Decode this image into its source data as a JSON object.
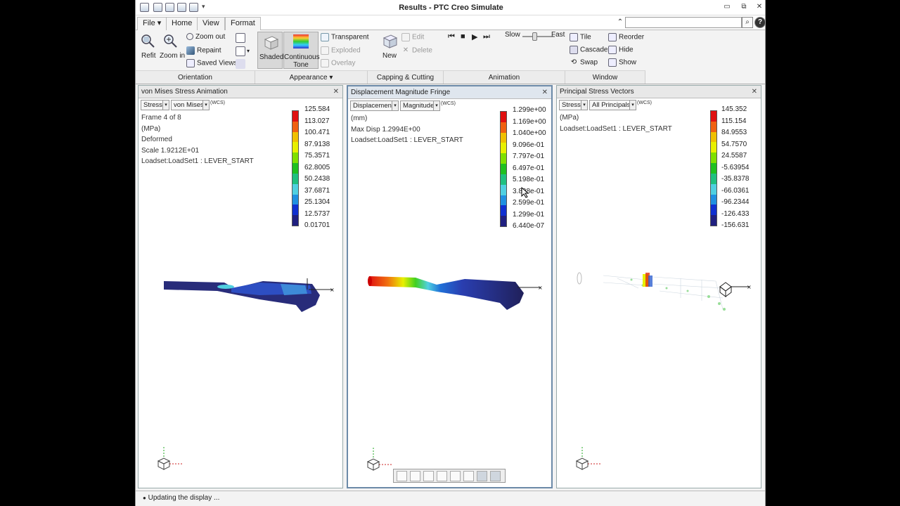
{
  "window": {
    "title": "Results - PTC Creo Simulate",
    "controls": [
      "minimize-icon",
      "restore-icon",
      "close-icon"
    ]
  },
  "tabs": [
    {
      "label": "File",
      "active": false
    },
    {
      "label": "Home",
      "active": false
    },
    {
      "label": "View",
      "active": true
    },
    {
      "label": "Format",
      "active": false
    }
  ],
  "search": {
    "value": ""
  },
  "ribbon": {
    "orientation": {
      "label": "Orientation",
      "refit": "Refit",
      "zoom_in": "Zoom in",
      "zoom_out": "Zoom out",
      "repaint": "Repaint",
      "saved_views": "Saved Views"
    },
    "appearance": {
      "label": "Appearance",
      "shaded": "Shaded",
      "continuous_tone_line1": "Continuous",
      "continuous_tone_line2": "Tone",
      "transparent": "Transparent",
      "exploded": "Exploded",
      "overlay": "Overlay"
    },
    "capping": {
      "label": "Capping & Cutting Surfs",
      "new": "New",
      "edit": "Edit",
      "delete": "Delete"
    },
    "animation": {
      "label": "Animation",
      "slow": "Slow",
      "fast": "Fast",
      "speed_fraction": 0.35
    },
    "window": {
      "label": "Window",
      "tile": "Tile",
      "cascade": "Cascade",
      "swap": "Swap",
      "reorder": "Reorder",
      "hide": "Hide",
      "show": "Show"
    }
  },
  "panels": [
    {
      "title": "von Mises Stress Animation",
      "dropdown1": "Stress",
      "dropdown2": "von Mises",
      "wcs": "(WCS)",
      "info": [
        "Frame 4 of 8",
        "(MPa)",
        "Deformed",
        "Scale  1.9212E+01",
        "Loadset:LoadSet1 :  LEVER_START"
      ],
      "legend": [
        "125.584",
        "113.027",
        "100.471",
        "87.9138",
        "75.3571",
        "62.8005",
        "50.2438",
        "37.6871",
        "25.1304",
        "12.5737",
        "0.01701"
      ]
    },
    {
      "title": "Displacement Magnitude Fringe",
      "dropdown1": "Displacement",
      "dropdown2": "Magnitude",
      "wcs": "(WCS)",
      "info": [
        "(mm)",
        "Max Disp  1.2994E+00",
        "Loadset:LoadSet1 :  LEVER_START"
      ],
      "legend": [
        "1.299e+00",
        "1.169e+00",
        "1.040e+00",
        "9.096e-01",
        "7.797e-01",
        "6.497e-01",
        "5.198e-01",
        "3.898e-01",
        "2.599e-01",
        "1.299e-01",
        "6.440e-07"
      ]
    },
    {
      "title": "Principal Stress Vectors",
      "dropdown1": "Stress",
      "dropdown2": "All Principals",
      "wcs": "(WCS)",
      "info": [
        "(MPa)",
        "Loadset:LoadSet1 :  LEVER_START"
      ],
      "legend": [
        "145.352",
        "115.154",
        "84.9553",
        "54.7570",
        "24.5587",
        "-5.63954",
        "-35.8378",
        "-66.0361",
        "-96.2344",
        "-126.433",
        "-156.631"
      ]
    }
  ],
  "fringe_colors": [
    "#e01010",
    "#f06010",
    "#f0c000",
    "#e8f000",
    "#80e000",
    "#20c020",
    "#20c080",
    "#50d0e0",
    "#2090e0",
    "#1030d0",
    "#202080"
  ],
  "status": {
    "text": "Updating the display ..."
  }
}
